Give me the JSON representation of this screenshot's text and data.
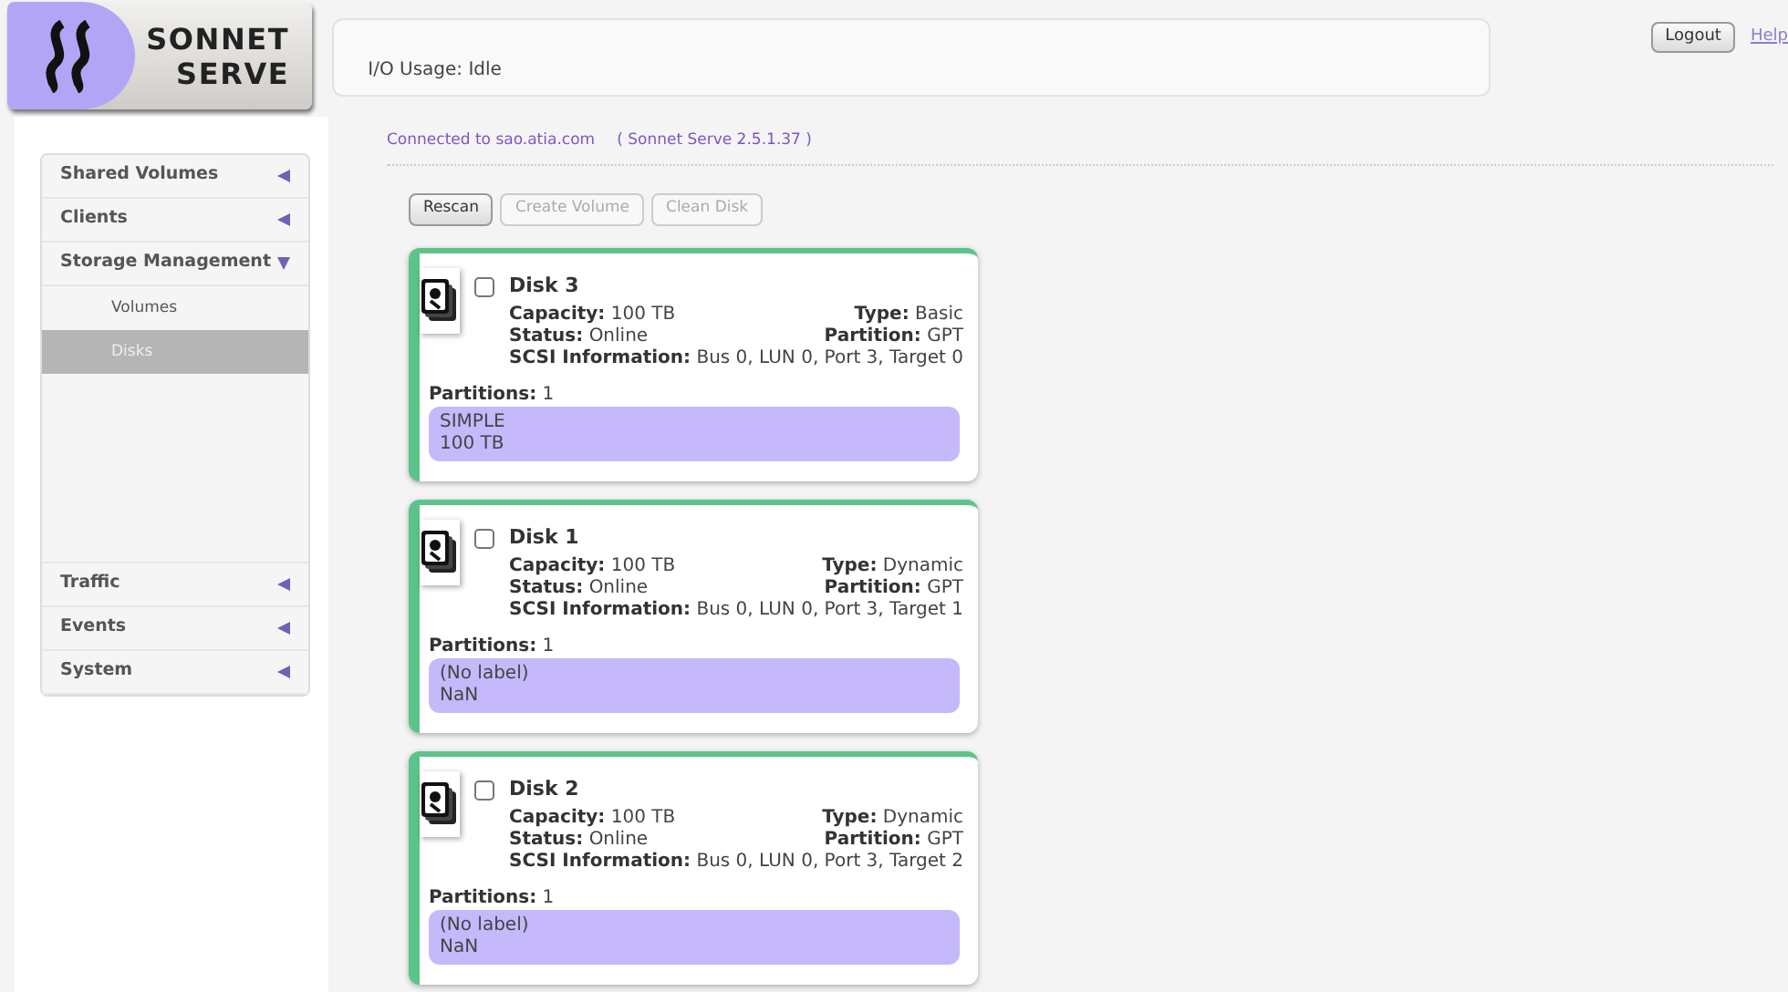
{
  "logo": {
    "line1": "SONNET",
    "line2": "SERVE"
  },
  "io_usage": "I/O Usage: Idle",
  "header_buttons": {
    "logout": "Logout",
    "help": "Help"
  },
  "connection": {
    "host": "Connected to sao.atia.com",
    "version": "( Sonnet Serve 2.5.1.37 )"
  },
  "sidebar": {
    "items": [
      {
        "label": "Shared Volumes",
        "expanded": false
      },
      {
        "label": "Clients",
        "expanded": false
      },
      {
        "label": "Storage Management",
        "expanded": true,
        "children": [
          {
            "label": "Volumes",
            "selected": false
          },
          {
            "label": "Disks",
            "selected": true
          }
        ]
      },
      {
        "label": "Traffic",
        "expanded": false
      },
      {
        "label": "Events",
        "expanded": false
      },
      {
        "label": "System",
        "expanded": false
      }
    ]
  },
  "toolbar": [
    {
      "label": "Rescan",
      "disabled": false
    },
    {
      "label": "Create Volume",
      "disabled": true
    },
    {
      "label": "Clean Disk",
      "disabled": true
    }
  ],
  "disks": [
    {
      "title": "Disk 3",
      "checked": false,
      "capacity": [
        "Capacity:",
        "100 TB"
      ],
      "type": [
        "Type:",
        "Basic"
      ],
      "status": [
        "Status:",
        "Online"
      ],
      "partition": [
        "Partition:",
        "GPT"
      ],
      "scsi": [
        "SCSI Information:",
        "Bus 0, LUN 0, Port 3, Target 0"
      ],
      "partitions": [
        "Partitions:",
        "1"
      ],
      "partition_block": [
        "SIMPLE",
        "100 TB"
      ]
    },
    {
      "title": "Disk 1",
      "checked": false,
      "capacity": [
        "Capacity:",
        "100 TB"
      ],
      "type": [
        "Type:",
        "Dynamic"
      ],
      "status": [
        "Status:",
        "Online"
      ],
      "partition": [
        "Partition:",
        "GPT"
      ],
      "scsi": [
        "SCSI Information:",
        "Bus 0, LUN 0, Port 3, Target 1"
      ],
      "partitions": [
        "Partitions:",
        "1"
      ],
      "partition_block": [
        "(No label)",
        "NaN"
      ]
    },
    {
      "title": "Disk 2",
      "checked": false,
      "capacity": [
        "Capacity:",
        "100 TB"
      ],
      "type": [
        "Type:",
        "Dynamic"
      ],
      "status": [
        "Status:",
        "Online"
      ],
      "partition": [
        "Partition:",
        "GPT"
      ],
      "scsi": [
        "SCSI Information:",
        "Bus 0, LUN 0, Port 3, Target 2"
      ],
      "partitions": [
        "Partitions:",
        "1"
      ],
      "partition_block": [
        "(No label)",
        "NaN"
      ]
    }
  ]
}
